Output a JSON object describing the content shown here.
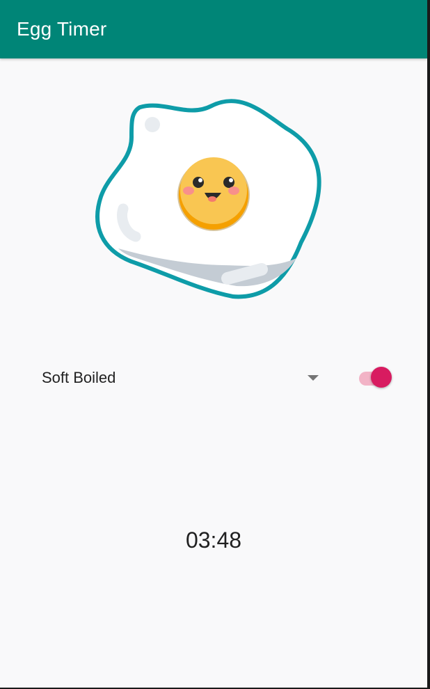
{
  "app_bar": {
    "title": "Egg Timer",
    "color": "#008577"
  },
  "egg_image": {
    "icon": "fried-egg-smiley"
  },
  "egg_selector": {
    "selected": "Soft Boiled"
  },
  "timer_switch": {
    "on": true,
    "color": "#D81B60"
  },
  "timer": {
    "time": "03:48"
  }
}
